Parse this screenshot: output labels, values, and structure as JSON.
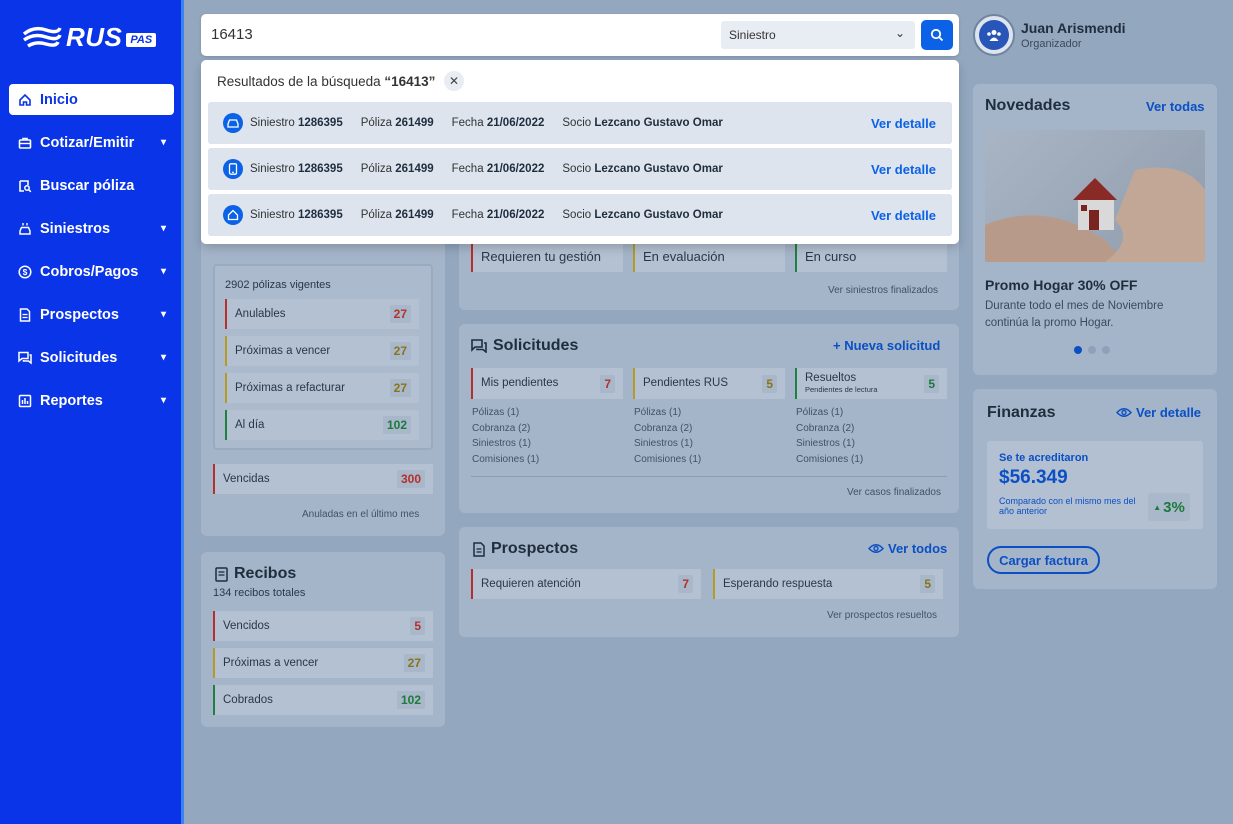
{
  "brand": {
    "name": "RUS",
    "badge": "PAS"
  },
  "nav": [
    {
      "label": "Inicio",
      "icon": "home-icon",
      "active": true
    },
    {
      "label": "Cotizar/Emitir",
      "icon": "briefcase-icon",
      "expandable": true
    },
    {
      "label": "Buscar póliza",
      "icon": "document-search-icon"
    },
    {
      "label": "Siniestros",
      "icon": "car-crash-icon",
      "expandable": true
    },
    {
      "label": "Cobros/Pagos",
      "icon": "dollar-icon",
      "expandable": true
    },
    {
      "label": "Prospectos",
      "icon": "document-icon",
      "expandable": true
    },
    {
      "label": "Solicitudes",
      "icon": "chat-icon",
      "expandable": true
    },
    {
      "label": "Reportes",
      "icon": "chart-icon",
      "expandable": true
    }
  ],
  "search": {
    "query": "16413",
    "type": "Siniestro"
  },
  "results": {
    "header_prefix": "Resultados de la búsqueda ",
    "header_query": "“16413”",
    "rows": [
      {
        "icon": "car-icon",
        "siniestro_label": "Siniestro",
        "siniestro": "1286395",
        "poliza_label": "Póliza",
        "poliza": "261499",
        "fecha_label": "Fecha",
        "fecha": "21/06/2022",
        "socio_label": "Socio",
        "socio": "Lezcano Gustavo Omar",
        "link": "Ver detalle"
      },
      {
        "icon": "phone-icon",
        "siniestro_label": "Siniestro",
        "siniestro": "1286395",
        "poliza_label": "Póliza",
        "poliza": "261499",
        "fecha_label": "Fecha",
        "fecha": "21/06/2022",
        "socio_label": "Socio",
        "socio": "Lezcano Gustavo Omar",
        "link": "Ver detalle"
      },
      {
        "icon": "house-icon",
        "siniestro_label": "Siniestro",
        "siniestro": "1286395",
        "poliza_label": "Póliza",
        "poliza": "261499",
        "fecha_label": "Fecha",
        "fecha": "21/06/2022",
        "socio_label": "Socio",
        "socio": "Lezcano Gustavo Omar",
        "link": "Ver detalle"
      }
    ]
  },
  "user": {
    "name": "Juan Arismendi",
    "role": "Organizador"
  },
  "polizas": {
    "vigentes": "2902 pólizas vigentes",
    "rows": [
      {
        "label": "Anulables",
        "value": "27",
        "status": "red"
      },
      {
        "label": "Próximas a vencer",
        "value": "27",
        "status": "yel"
      },
      {
        "label": "Próximas a refacturar",
        "value": "27",
        "status": "yel"
      },
      {
        "label": "Al día",
        "value": "102",
        "status": "grn"
      }
    ],
    "vencidas": {
      "label": "Vencidas",
      "value": "300"
    },
    "footer": "Anuladas en el último mes"
  },
  "recibos": {
    "title": "Recibos",
    "subtitle": "134 recibos totales",
    "rows": [
      {
        "label": "Vencidos",
        "value": "5",
        "status": "red"
      },
      {
        "label": "Próximas a vencer",
        "value": "27",
        "status": "yel"
      },
      {
        "label": "Cobrados",
        "value": "102",
        "status": "grn"
      }
    ]
  },
  "siniestros": {
    "cols": [
      "Requieren tu gestión",
      "En evaluación",
      "En curso"
    ],
    "footer": "Ver siniestros finalizados"
  },
  "solicitudes": {
    "title": "Solicitudes",
    "action": "+ Nueva solicitud",
    "cols": [
      {
        "label": "Mis pendientes",
        "sub": "",
        "value": "7",
        "status": "red",
        "items": [
          "Pólizas (1)",
          "Cobranza (2)",
          "Siniestros (1)",
          "Comisiones (1)"
        ]
      },
      {
        "label": "Pendientes RUS",
        "sub": "",
        "value": "5",
        "status": "yel",
        "items": [
          "Pólizas (1)",
          "Cobranza (2)",
          "Siniestros (1)",
          "Comisiones (1)"
        ]
      },
      {
        "label": "Resueltos",
        "sub": "Pendientes de lectura",
        "value": "5",
        "status": "grn",
        "items": [
          "Pólizas (1)",
          "Cobranza (2)",
          "Siniestros (1)",
          "Comisiones (1)"
        ]
      }
    ],
    "footer": "Ver casos finalizados"
  },
  "prospectos": {
    "title": "Prospectos",
    "action": "Ver todos",
    "rows": [
      {
        "label": "Requieren atención",
        "value": "7",
        "status": "red"
      },
      {
        "label": "Esperando respuesta",
        "value": "5",
        "status": "yel"
      }
    ],
    "footer": "Ver prospectos resueltos"
  },
  "novedades": {
    "title": "Novedades",
    "action": "Ver todas",
    "promo_title": "Promo Hogar 30% OFF",
    "promo_text": "Durante todo el mes de Noviembre continúa la promo Hogar.",
    "carousel": {
      "dots": 3,
      "active": 0
    }
  },
  "finanzas": {
    "title": "Finanzas",
    "action": "Ver detalle",
    "acreditado_label": "Se te acreditaron",
    "amount": "$56.349",
    "comparison": "Comparado con el mismo mes del año anterior",
    "change": "3%",
    "button": "Cargar factura"
  },
  "colors": {
    "brand": "#0a34e8",
    "accent": "#0b62e6",
    "red": "#b5302b",
    "yellow": "#8a7418",
    "green": "#1d7a3a"
  }
}
